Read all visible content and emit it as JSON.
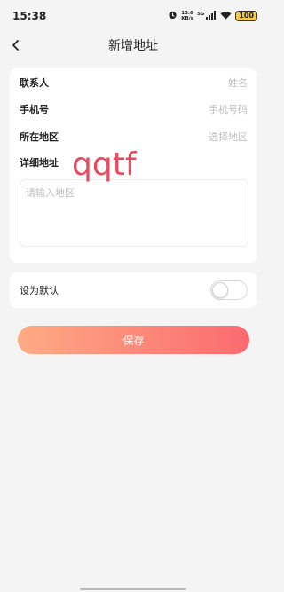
{
  "status_bar": {
    "time": "15:38",
    "speed_value": "13.6",
    "speed_unit": "KB/s",
    "network": "5G",
    "battery": "100"
  },
  "nav": {
    "title": "新增地址"
  },
  "form": {
    "contact_label": "联系人",
    "contact_placeholder": "姓名",
    "phone_label": "手机号",
    "phone_placeholder": "手机号码",
    "region_label": "所在地区",
    "region_placeholder": "选择地区",
    "detail_label": "详细地址",
    "detail_placeholder": "请输入地区",
    "handwriting": "qqtf"
  },
  "default_setting": {
    "label": "设为默认",
    "enabled": false
  },
  "save_label": "保存",
  "colors": {
    "save_gradient_start": "#fdab84",
    "save_gradient_end": "#fc6a70",
    "handwriting": "#e84a5f"
  }
}
